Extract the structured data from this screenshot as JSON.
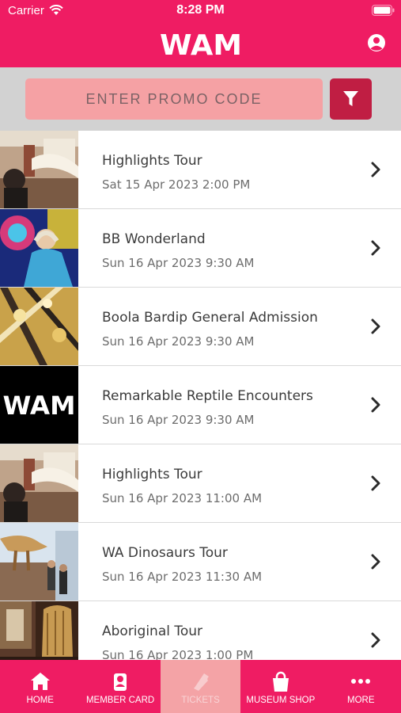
{
  "status_bar": {
    "carrier": "Carrier",
    "time": "8:28 PM"
  },
  "header": {
    "logo_text": "WAM"
  },
  "promo": {
    "placeholder": "ENTER PROMO CODE"
  },
  "events": [
    {
      "title": "Highlights Tour",
      "date": "Sat 15 Apr 2023 2:00 PM",
      "thumb": "gallery-photo"
    },
    {
      "title": "BB Wonderland",
      "date": "Sun 16 Apr 2023 9:30 AM",
      "thumb": "colorful-art-photo"
    },
    {
      "title": "Boola Bardip General Admission",
      "date": "Sun 16 Apr 2023 9:30 AM",
      "thumb": "ceiling-art-photo"
    },
    {
      "title": "Remarkable Reptile Encounters",
      "date": "Sun 16 Apr 2023 9:30 AM",
      "thumb": "wam-logo"
    },
    {
      "title": "Highlights Tour",
      "date": "Sun 16 Apr 2023 11:00 AM",
      "thumb": "gallery-photo"
    },
    {
      "title": "WA Dinosaurs Tour",
      "date": "Sun 16 Apr 2023 11:30 AM",
      "thumb": "dinosaur-photo"
    },
    {
      "title": "Aboriginal Tour",
      "date": "Sun 16 Apr 2023 1:00 PM",
      "thumb": "exhibit-photo"
    }
  ],
  "tabs": [
    {
      "label": "HOME",
      "icon": "home-icon"
    },
    {
      "label": "MEMBER CARD",
      "icon": "member-card-icon"
    },
    {
      "label": "TICKETS",
      "icon": "ticket-icon",
      "active": true
    },
    {
      "label": "MUSEUM SHOP",
      "icon": "shopping-bag-icon"
    },
    {
      "label": "MORE",
      "icon": "more-icon"
    }
  ],
  "colors": {
    "brand": "#ef1c63",
    "promo_field": "#f5a1a4",
    "filter_button": "#c01e43",
    "active_tab": "#f4a3a6"
  }
}
